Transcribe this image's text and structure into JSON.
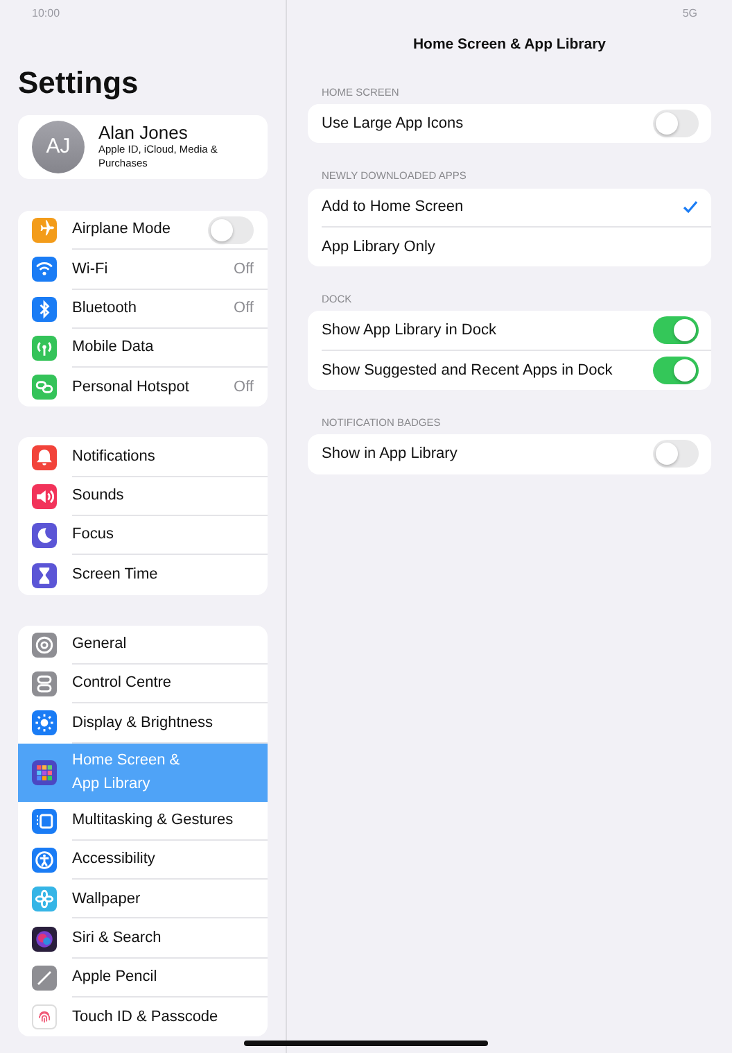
{
  "status_bar": {
    "time": "10:00",
    "network": "5G"
  },
  "sidebar": {
    "title": "Settings",
    "profile": {
      "initials": "AJ",
      "name": "Alan Jones",
      "subtitle": "Apple ID, iCloud, Media & Purchases"
    },
    "groups": [
      {
        "items": [
          {
            "label": "Airplane Mode",
            "kind": "toggle",
            "on": false,
            "color": "#f39c1a",
            "selected": false
          },
          {
            "label": "Wi-Fi",
            "kind": "value",
            "value": "Off",
            "color": "#1a7cf5",
            "selected": false
          },
          {
            "label": "Bluetooth",
            "kind": "value",
            "value": "Off",
            "color": "#1a7cf5",
            "selected": false
          },
          {
            "label": "Mobile Data",
            "kind": "plain",
            "color": "#34c359",
            "selected": false
          },
          {
            "label": "Personal Hotspot",
            "kind": "value",
            "value": "Off",
            "color": "#34c359",
            "selected": false
          }
        ]
      },
      {
        "items": [
          {
            "label": "Notifications",
            "kind": "plain",
            "color": "#f2433a",
            "selected": false
          },
          {
            "label": "Sounds",
            "kind": "plain",
            "color": "#f2335a",
            "selected": false
          },
          {
            "label": "Focus",
            "kind": "plain",
            "color": "#5b55d6",
            "selected": false
          },
          {
            "label": "Screen Time",
            "kind": "plain",
            "color": "#5b55d6",
            "selected": false
          }
        ]
      },
      {
        "items": [
          {
            "label": "General",
            "kind": "plain",
            "color": "#8e8e93",
            "selected": false
          },
          {
            "label": "Control Centre",
            "kind": "plain",
            "color": "#8e8e93",
            "selected": false
          },
          {
            "label": "Display & Brightness",
            "kind": "plain",
            "color": "#1a7cf5",
            "selected": false
          },
          {
            "label": "Home Screen & App Library",
            "kind": "plain",
            "color": "#4b47c2",
            "selected": true
          },
          {
            "label": "Multitasking & Gestures",
            "kind": "plain",
            "color": "#1a7cf5",
            "selected": false
          },
          {
            "label": "Accessibility",
            "kind": "plain",
            "color": "#1a7cf5",
            "selected": false
          },
          {
            "label": "Wallpaper",
            "kind": "plain",
            "color": "#35b5e6",
            "selected": false
          },
          {
            "label": "Siri & Search",
            "kind": "plain",
            "color": "#2a1f3d",
            "selected": false
          },
          {
            "label": "Apple Pencil",
            "kind": "plain",
            "color": "#8e8e93",
            "selected": false
          },
          {
            "label": "Touch ID & Passcode",
            "kind": "plain",
            "color": "#ffffff",
            "selected": false
          }
        ]
      }
    ]
  },
  "detail": {
    "title": "Home Screen & App Library",
    "sections": [
      {
        "header": "HOME SCREEN",
        "rows": [
          {
            "label": "Use Large App Icons",
            "kind": "toggle",
            "on": false
          }
        ]
      },
      {
        "header": "NEWLY DOWNLOADED APPS",
        "rows": [
          {
            "label": "Add to Home Screen",
            "kind": "choice",
            "selected": true
          },
          {
            "label": "App Library Only",
            "kind": "choice",
            "selected": false
          }
        ]
      },
      {
        "header": "DOCK",
        "rows": [
          {
            "label": "Show App Library in Dock",
            "kind": "toggle",
            "on": true
          },
          {
            "label": "Show Suggested and Recent Apps in Dock",
            "kind": "toggle",
            "on": true
          }
        ]
      },
      {
        "header": "NOTIFICATION BADGES",
        "rows": [
          {
            "label": "Show in App Library",
            "kind": "toggle",
            "on": false
          }
        ]
      }
    ]
  }
}
